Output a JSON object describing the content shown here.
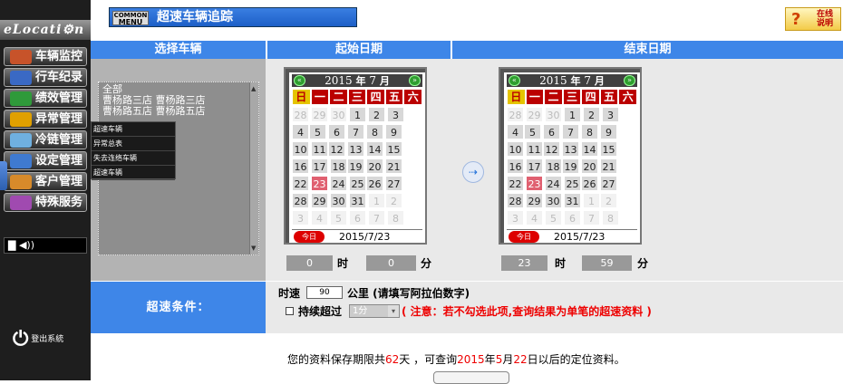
{
  "sidebar": {
    "logo": "eLocati⚙n",
    "items": [
      {
        "label": "车辆监控",
        "color": "#c7532a"
      },
      {
        "label": "行车纪录",
        "color": "#3a69c4"
      },
      {
        "label": "绩效管理",
        "color": "#2f9a3a"
      },
      {
        "label": "异常管理",
        "color": "#e0a000"
      },
      {
        "label": "冷链管理",
        "color": "#6fb0e0"
      },
      {
        "label": "设定管理",
        "color": "#3f7ad0"
      },
      {
        "label": "客户管理",
        "color": "#d78a2a"
      },
      {
        "label": "特殊服务",
        "color": "#a04ab0"
      }
    ],
    "status_bar": "▇ ◀))",
    "logout": "登出系統",
    "logout_icon": "power-icon"
  },
  "header": {
    "menu_badge_top": "COMMON",
    "menu_badge_bottom": "MENU",
    "title": "超速车辆追踪",
    "help_line1": "在线",
    "help_line2": "说明"
  },
  "columns": {
    "select": "选择车辆",
    "start": "起始日期",
    "end": "结束日期"
  },
  "vehicle_list": [
    "全部",
    "曹杨路三店 曹杨路三店",
    "曹杨路五店 曹杨路五店"
  ],
  "dropdown_menu": [
    "超速车辆",
    "异常总表",
    "失去连络车辆",
    "超速车辆"
  ],
  "calendars": {
    "weekdays": [
      "日",
      "一",
      "二",
      "三",
      "四",
      "五",
      "六"
    ],
    "year": "2015",
    "year_unit": "年",
    "month": "7",
    "month_unit": "月",
    "today_button": "今日",
    "today_date": "2015/7/23",
    "days": [
      "28",
      "29",
      "30",
      "1",
      "2",
      "3",
      "4",
      "5",
      "6",
      "7",
      "8",
      "9",
      "10",
      "11",
      "12",
      "13",
      "14",
      "15",
      "16",
      "17",
      "18",
      "19",
      "20",
      "21",
      "22",
      "23",
      "24",
      "25",
      "26",
      "27",
      "28",
      "29",
      "30",
      "31",
      "1",
      "2",
      "3",
      "4",
      "5",
      "6",
      "7",
      "8"
    ],
    "out_of_month_indexes": [
      0,
      1,
      2,
      34,
      35,
      36,
      37,
      38,
      39,
      40,
      41
    ],
    "highlight_index": 25,
    "highlight_color": "#e06070"
  },
  "start_time": {
    "hour": "0",
    "hour_unit": "时",
    "minute": "0",
    "minute_unit": "分"
  },
  "end_time": {
    "hour": "23",
    "hour_unit": "时",
    "minute": "59",
    "minute_unit": "分"
  },
  "speed": {
    "header": "超速条件：",
    "label": "时速",
    "value": "90",
    "unit_note": "公里 (请填写阿拉伯数字)",
    "continuous_label": "持续超过",
    "continuous_value": "1分",
    "note": "( 注意：若不勾选此项,查询结果为单笔的超速资料 )"
  },
  "footer": {
    "p1": "您的资料保存期限共",
    "days": "62",
    "p2": "天 ，可查询",
    "year": "2015",
    "p3": "年",
    "month": "5",
    "p4": "月",
    "day": "22",
    "p5": "日以后的定位资料。"
  }
}
